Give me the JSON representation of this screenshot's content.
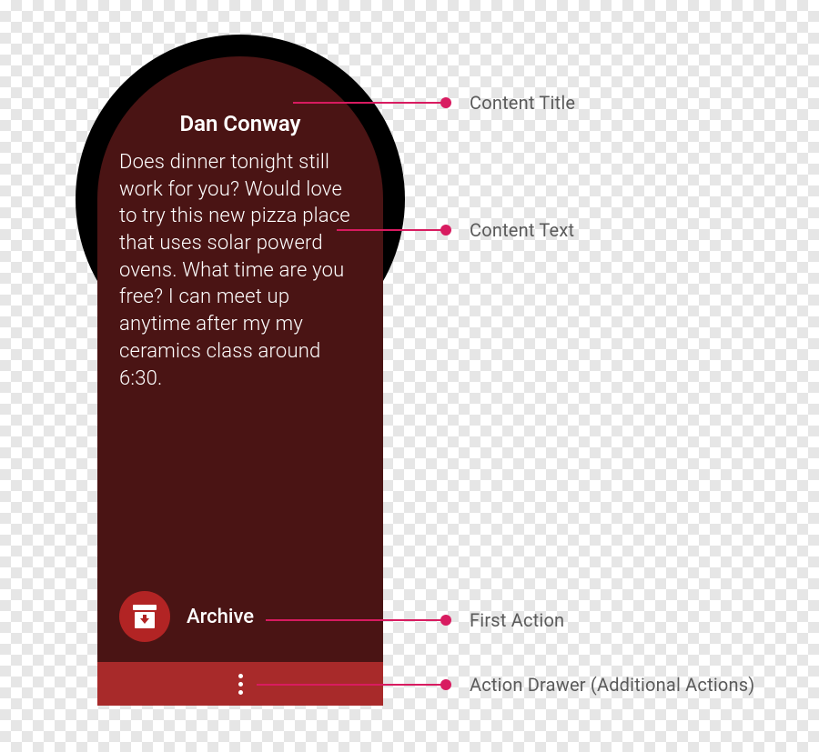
{
  "notification": {
    "title": "Dan Conway",
    "body": "Does dinner tonight still work for you? Would love to try this new pizza place that uses solar powerd ovens. What time are you free? I can meet up anytime after my my ceramics class around 6:30.",
    "first_action": {
      "label": "Archive",
      "icon": "archive-icon"
    },
    "drawer_icon": "more-vertical-icon"
  },
  "annotations": {
    "title": "Content Title",
    "body": "Content Text",
    "first_action": "First Action",
    "drawer": "Action Drawer (Additional Actions)"
  },
  "colors": {
    "bezel": "#000000",
    "card_bg": "#4a1414",
    "action_circle": "#b22424",
    "drawer_bg": "#a82a2a",
    "annotation_pink": "#d81b60",
    "label_gray": "#5a5a5a"
  }
}
